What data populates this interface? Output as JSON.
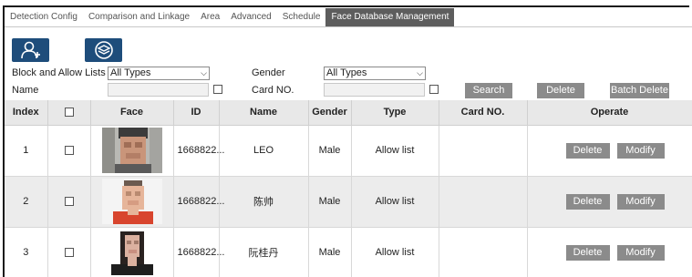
{
  "tabs": [
    {
      "label": "Detection Config",
      "active": false
    },
    {
      "label": "Comparison and Linkage",
      "active": false
    },
    {
      "label": "Area",
      "active": false
    },
    {
      "label": "Advanced",
      "active": false
    },
    {
      "label": "Schedule",
      "active": false
    },
    {
      "label": "Face Database Management",
      "active": true
    }
  ],
  "toolbar": {
    "add_icon": "add-person-icon",
    "import_icon": "layers-import-icon"
  },
  "filters": {
    "list_label": "Block and Allow Lists",
    "list_value": "All Types",
    "gender_label": "Gender",
    "gender_value": "All Types",
    "name_label": "Name",
    "name_value": "",
    "card_label": "Card NO.",
    "card_value": ""
  },
  "actions": {
    "search": "Search",
    "delete": "Delete",
    "batch_delete": "Batch Delete"
  },
  "table": {
    "columns": [
      "Index",
      "",
      "Face",
      "ID",
      "Name",
      "Gender",
      "Type",
      "Card NO.",
      "Operate"
    ],
    "rows": [
      {
        "index": "1",
        "id": "1668822...",
        "name": "LEO",
        "gender": "Male",
        "type": "Allow list",
        "card": "",
        "delete": "Delete",
        "modify": "Modify"
      },
      {
        "index": "2",
        "id": "1668822...",
        "name": "陈帅",
        "gender": "Male",
        "type": "Allow list",
        "card": "",
        "delete": "Delete",
        "modify": "Modify"
      },
      {
        "index": "3",
        "id": "1668822...",
        "name": "阮桂丹",
        "gender": "Male",
        "type": "Allow list",
        "card": "",
        "delete": "Delete",
        "modify": "Modify"
      }
    ]
  },
  "colors": {
    "active_tab": "#5d5d5d",
    "icon_button": "#1e4d7b",
    "gray_button": "#8b8b8b",
    "header_bg": "#e8e8e8"
  }
}
